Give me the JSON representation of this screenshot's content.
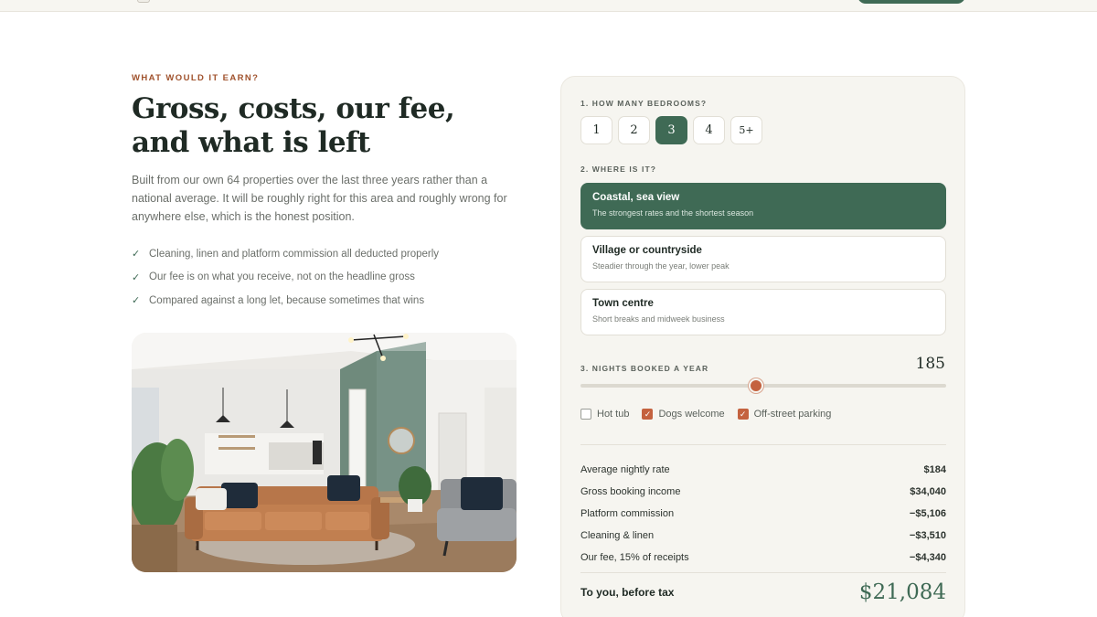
{
  "intro_block": {
    "eyebrow": "WHAT WOULD IT EARN?",
    "headline": "Gross, costs, our fee, and what is left",
    "body": "Built from our own 64 properties over the last three years rather than a national average. It will be roughly right for this area and roughly wrong for anywhere else, which is the honest position.",
    "checklist": [
      "Cleaning, linen and platform commission all deducted properly",
      "Our fee is on what you receive, not on the headline gross",
      "Compared against a long let, because sometimes that wins"
    ],
    "photo": "living-room-photo"
  },
  "calculator": {
    "bedrooms_label": "1. HOW MANY BEDROOMS?",
    "bedroom_options": [
      "1",
      "2",
      "3",
      "4",
      "5+"
    ],
    "bedrooms_selected": "3",
    "location_label": "2. WHERE IS IT?",
    "locations": [
      {
        "title": "Coastal, sea view",
        "subtitle": "The strongest rates and the shortest season",
        "selected": true
      },
      {
        "title": "Village or countryside",
        "subtitle": "Steadier through the year, lower peak",
        "selected": false
      },
      {
        "title": "Town centre",
        "subtitle": "Short breaks and midweek business",
        "selected": false
      }
    ],
    "nights_label": "3. NIGHTS BOOKED A YEAR",
    "nights_value": "185",
    "nights_fraction": 0.48,
    "extras": [
      {
        "label": "Hot tub",
        "checked": false
      },
      {
        "label": "Dogs welcome",
        "checked": true
      },
      {
        "label": "Off-street parking",
        "checked": true
      }
    ],
    "breakdown": [
      {
        "label": "Average nightly rate",
        "value": "$184"
      },
      {
        "label": "Gross booking income",
        "value": "$34,040"
      },
      {
        "label": "Platform commission",
        "value": "−$5,106"
      },
      {
        "label": "Cleaning & linen",
        "value": "−$3,510"
      },
      {
        "label": "Our fee, 15% of receipts",
        "value": "−$4,340"
      }
    ],
    "total_label": "To you, before tax",
    "total_value": "$21,084"
  },
  "colors": {
    "accent_green": "#3f6a55",
    "accent_rust": "#c4623f",
    "card_bg": "#f6f5f0"
  }
}
